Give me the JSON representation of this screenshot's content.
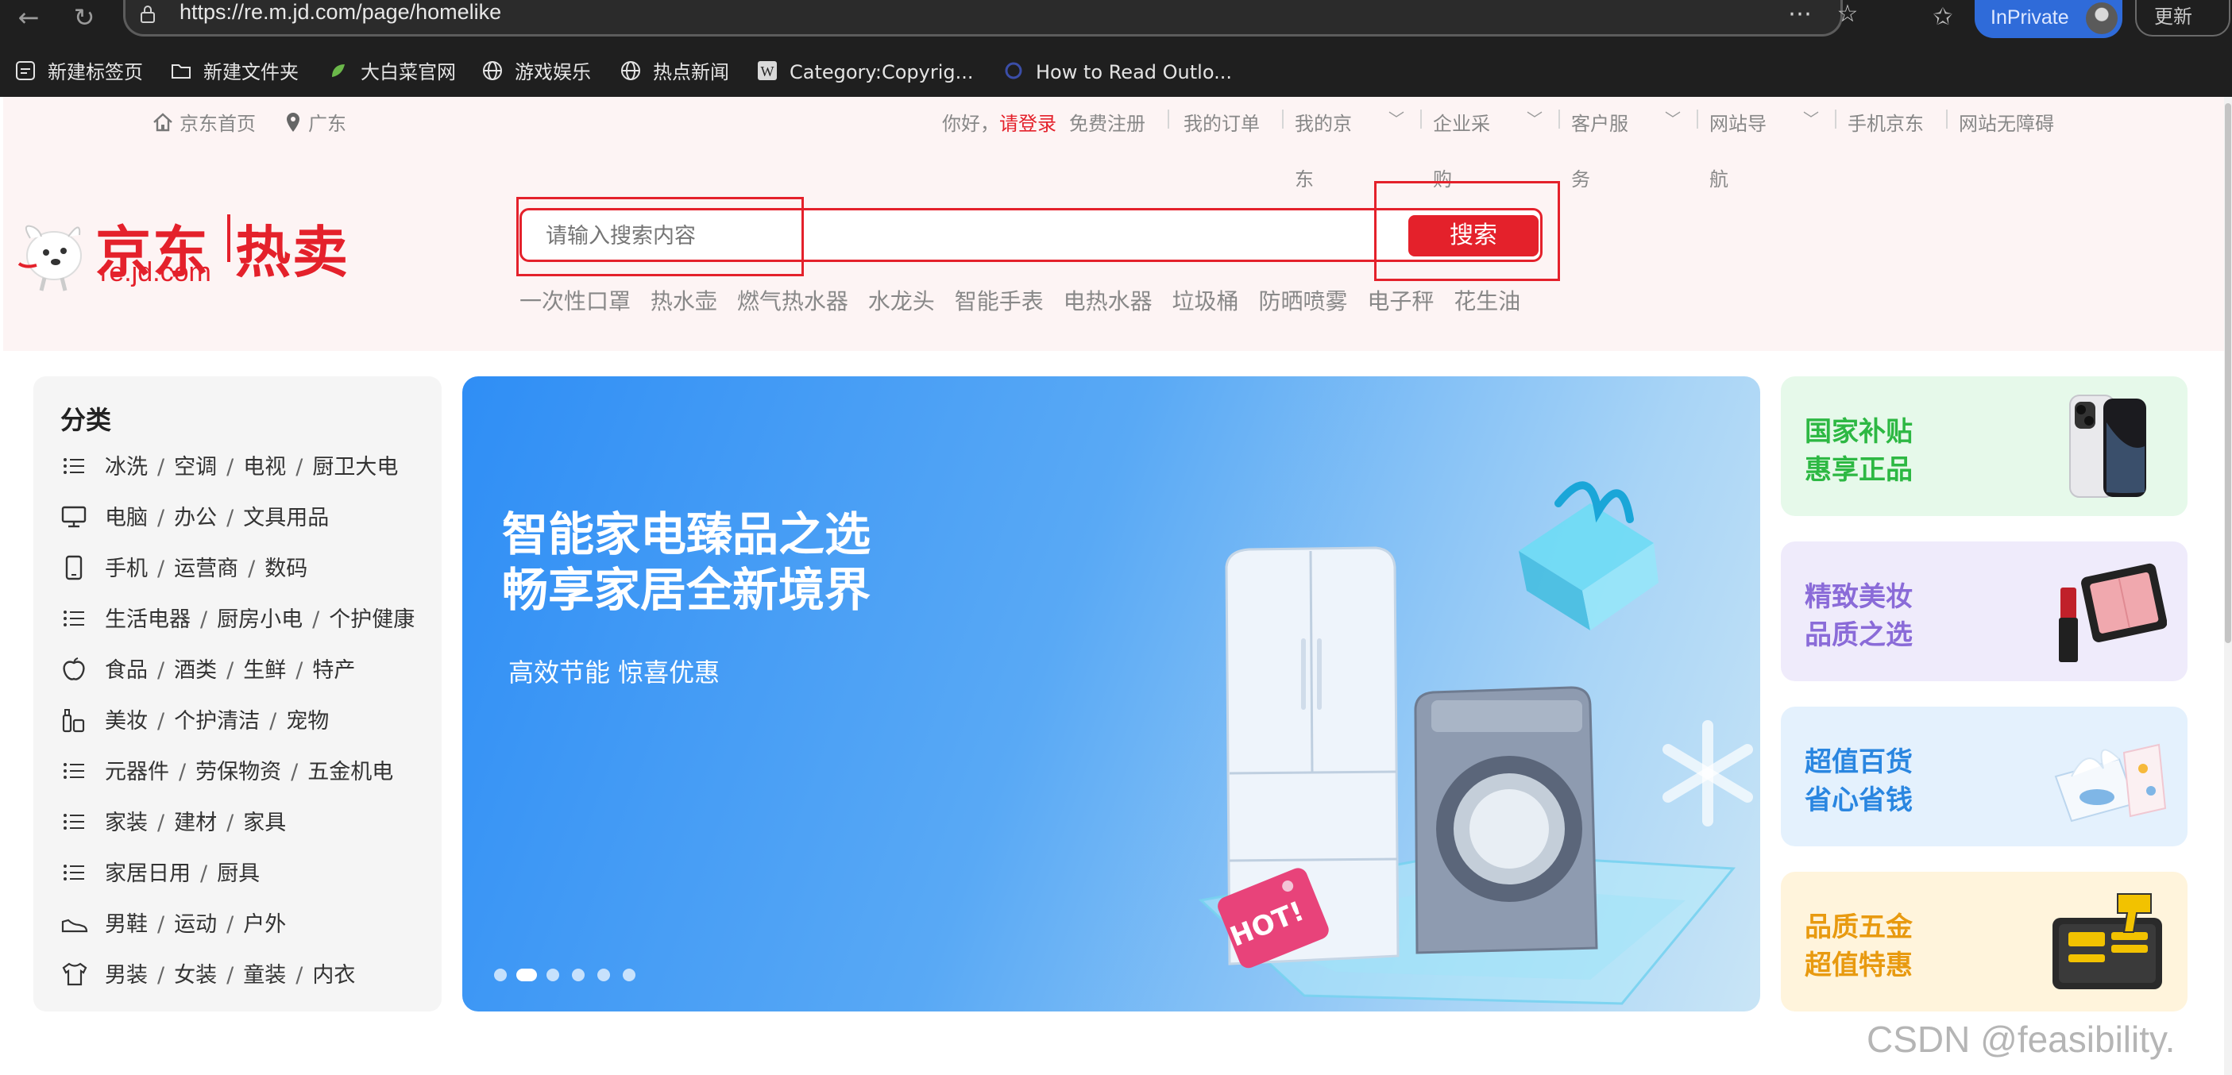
{
  "browser": {
    "url": "https://re.m.jd.com/page/homelike",
    "inprivate_label": "InPrivate",
    "update_label": "更新",
    "bookmarks": [
      {
        "label": "新建标签页",
        "icon": "new-tab-icon"
      },
      {
        "label": "新建文件夹",
        "icon": "folder-icon"
      },
      {
        "label": "大白菜官网",
        "icon": "site-favicon"
      },
      {
        "label": "游戏娱乐",
        "icon": "globe-icon"
      },
      {
        "label": "热点新闻",
        "icon": "globe-icon"
      },
      {
        "label": "Category:Copyrig...",
        "icon": "wikipedia-icon"
      },
      {
        "label": "How to Read Outlo...",
        "icon": "outlook-icon"
      }
    ]
  },
  "topbar": {
    "home": "京东首页",
    "location": "广东",
    "greeting": "你好，",
    "login": "请登录",
    "register": "免费注册",
    "links": [
      {
        "label": "我的订单",
        "wrap": ""
      },
      {
        "label": "我的京",
        "wrap": "东"
      },
      {
        "label": "企业采",
        "wrap": "购"
      },
      {
        "label": "客户服",
        "wrap": "务"
      },
      {
        "label": "网站导",
        "wrap": "航"
      },
      {
        "label": "手机京东",
        "wrap": ""
      },
      {
        "label": "网站无障碍",
        "wrap": ""
      }
    ]
  },
  "logo": {
    "main": "京东",
    "secondary": "热卖",
    "sub": "re.jd.com"
  },
  "search": {
    "placeholder": "请输入搜索内容",
    "button": "搜索",
    "hotwords": [
      "一次性口罩",
      "热水壶",
      "燃气热水器",
      "水龙头",
      "智能手表",
      "电热水器",
      "垃圾桶",
      "防晒喷雾",
      "电子秤",
      "花生油"
    ]
  },
  "categories": {
    "title": "分类",
    "rows": [
      {
        "icon": "list-icon",
        "items": [
          "冰洗",
          "空调",
          "电视",
          "厨卫大电"
        ]
      },
      {
        "icon": "monitor-icon",
        "items": [
          "电脑",
          "办公",
          "文具用品"
        ]
      },
      {
        "icon": "phone-icon",
        "items": [
          "手机",
          "运营商",
          "数码"
        ]
      },
      {
        "icon": "list-icon",
        "items": [
          "生活电器",
          "厨房小电",
          "个护健康"
        ]
      },
      {
        "icon": "apple-icon",
        "items": [
          "食品",
          "酒类",
          "生鲜",
          "特产"
        ]
      },
      {
        "icon": "cosmetics-icon",
        "items": [
          "美妆",
          "个护清洁",
          "宠物"
        ]
      },
      {
        "icon": "list-icon",
        "items": [
          "元器件",
          "劳保物资",
          "五金机电"
        ]
      },
      {
        "icon": "list-icon",
        "items": [
          "家装",
          "建材",
          "家具"
        ]
      },
      {
        "icon": "list-icon",
        "items": [
          "家居日用",
          "厨具"
        ]
      },
      {
        "icon": "shoe-icon",
        "items": [
          "男鞋",
          "运动",
          "户外"
        ]
      },
      {
        "icon": "tshirt-icon",
        "items": [
          "男装",
          "女装",
          "童装",
          "内衣"
        ]
      }
    ]
  },
  "banner": {
    "headline1": "智能家电臻品之选",
    "headline2": "畅享家居全新境界",
    "subline": "高效节能 惊喜优惠",
    "tag": "HOT!",
    "slide_count": 6,
    "active_slide": 2
  },
  "promos": [
    {
      "line1": "国家补贴",
      "line2": "惠享正品",
      "color": "#2db843",
      "bg": "#e6f9ea",
      "image": "smartphone-image"
    },
    {
      "line1": "精致美妆",
      "line2": "品质之选",
      "color": "#8a6bd8",
      "bg": "#efebfb",
      "image": "makeup-image"
    },
    {
      "line1": "超值百货",
      "line2": "省心省钱",
      "color": "#2a86e0",
      "bg": "#e4f1fd",
      "image": "tissue-image"
    },
    {
      "line1": "品质五金",
      "line2": "超值特惠",
      "color": "#e89a10",
      "bg": "#fff4dc",
      "image": "toolkit-image"
    }
  ],
  "watermark": "CSDN @feasibility.",
  "colors": {
    "brand": "#e4212b",
    "header_bg": "#fdf4f4"
  }
}
